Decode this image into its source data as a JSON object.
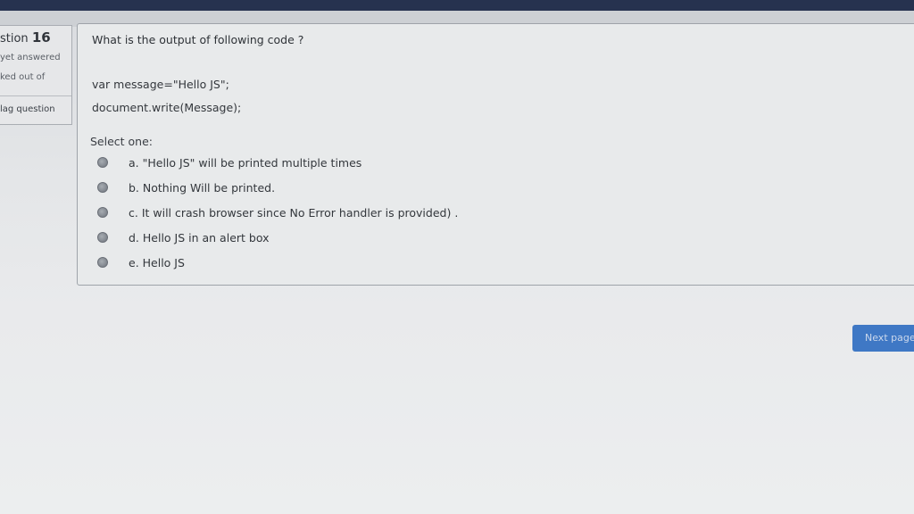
{
  "question_info": {
    "title_prefix": "stion",
    "number": "16",
    "status": "yet answered",
    "marks": "ked out of",
    "flag_label": "lag question"
  },
  "question": {
    "text": "What is the output of following code ?",
    "code": [
      "var message=\"Hello JS\";",
      "document.write(Message);"
    ],
    "select_label": "Select one:",
    "options": [
      "a. \"Hello JS\" will be printed multiple times",
      "b. Nothing Will be printed.",
      "c. It will crash browser since No Error handler is provided) .",
      "d. Hello JS in an alert box",
      "e. Hello JS"
    ]
  },
  "nav": {
    "next_label": "Next page"
  },
  "colors": {
    "top_bar": "#26324f",
    "next_button": "#3f78c5"
  }
}
